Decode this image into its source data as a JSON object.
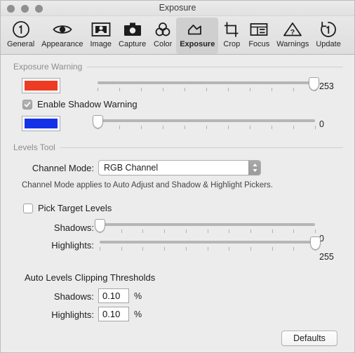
{
  "window": {
    "title": "Exposure",
    "traffic_lights": [
      "close",
      "minimize",
      "maximize"
    ]
  },
  "toolbar": {
    "items": [
      {
        "label": "General",
        "icon": "circled-one-icon",
        "selected": false
      },
      {
        "label": "Appearance",
        "icon": "eye-icon",
        "selected": false
      },
      {
        "label": "Image",
        "icon": "portrait-icon",
        "selected": false
      },
      {
        "label": "Capture",
        "icon": "camera-icon",
        "selected": false
      },
      {
        "label": "Color",
        "icon": "color-circles-icon",
        "selected": false
      },
      {
        "label": "Exposure",
        "icon": "exposure-icon",
        "selected": true
      },
      {
        "label": "Crop",
        "icon": "crop-icon",
        "selected": false
      },
      {
        "label": "Focus",
        "icon": "focus-grid-icon",
        "selected": false
      },
      {
        "label": "Warnings",
        "icon": "warning-triangle-icon",
        "selected": false
      },
      {
        "label": "Update",
        "icon": "update-circled-one-icon",
        "selected": false
      }
    ]
  },
  "exposure_warning": {
    "section_title": "Exposure Warning",
    "highlight_swatch_color": "#ee3b24",
    "highlight_slider": {
      "value": 253,
      "min": 0,
      "max": 255,
      "ticks": 11
    },
    "shadow_checkbox": {
      "label": "Enable Shadow Warning",
      "checked": true
    },
    "shadow_swatch_color": "#1432e8",
    "shadow_slider": {
      "value": 0,
      "min": 0,
      "max": 255,
      "ticks": 11
    }
  },
  "levels_tool": {
    "section_title": "Levels Tool",
    "channel_mode_label": "Channel Mode:",
    "channel_mode_value": "RGB Channel",
    "channel_mode_options": [
      "RGB Channel"
    ],
    "note": "Channel Mode applies to Auto Adjust and Shadow & Highlight Pickers.",
    "pick_target_levels": {
      "label": "Pick Target Levels",
      "checked": false
    },
    "shadows_label": "Shadows:",
    "shadows_value": 0,
    "shadows_slider": {
      "value": 0,
      "min": 0,
      "max": 255,
      "ticks": 11
    },
    "highlights_label": "Highlights:",
    "highlights_value": 255,
    "highlights_slider": {
      "value": 255,
      "min": 0,
      "max": 255,
      "ticks": 11
    }
  },
  "auto_levels": {
    "group_title": "Auto Levels Clipping Thresholds",
    "shadows_label": "Shadows:",
    "shadows_value": "0.10",
    "shadows_unit": "%",
    "highlights_label": "Highlights:",
    "highlights_value": "0.10",
    "highlights_unit": "%"
  },
  "footer": {
    "defaults_label": "Defaults"
  }
}
